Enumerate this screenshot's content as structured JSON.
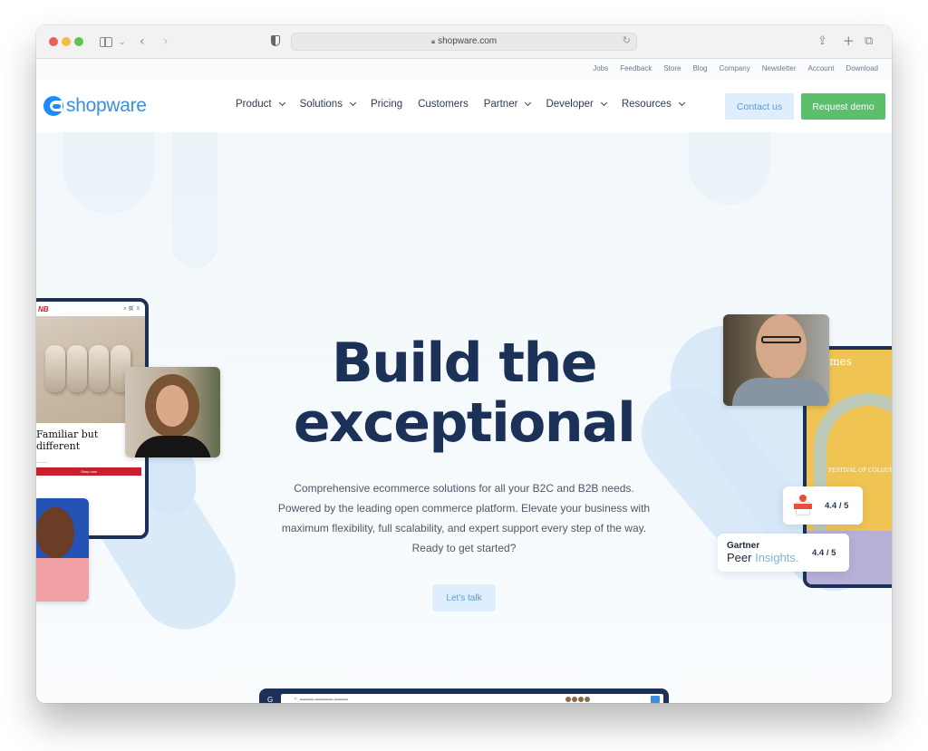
{
  "browser": {
    "url": "shopware.com",
    "icons": {
      "sidebar": "sidebar-icon",
      "back": "chevron-left-icon",
      "forward": "chevron-right-icon",
      "privacy": "shield-icon",
      "reload": "reload-icon",
      "share": "share-icon",
      "new_tab": "plus-icon",
      "tabs": "tabs-overview-icon"
    }
  },
  "utility_nav": [
    "Jobs",
    "Feedback",
    "Store",
    "Blog",
    "Company",
    "Newsletter",
    "Account",
    "Download"
  ],
  "main_nav": {
    "logo": "shopware",
    "links": [
      {
        "label": "Product",
        "dropdown": true
      },
      {
        "label": "Solutions",
        "dropdown": true
      },
      {
        "label": "Pricing",
        "dropdown": false
      },
      {
        "label": "Customers",
        "dropdown": false
      },
      {
        "label": "Partner",
        "dropdown": true
      },
      {
        "label": "Developer",
        "dropdown": true
      },
      {
        "label": "Resources",
        "dropdown": true
      }
    ],
    "contact_label": "Contact us",
    "demo_label": "Request demo"
  },
  "hero": {
    "title_line1": "Build the",
    "title_line2": "exceptional",
    "description": "Comprehensive ecommerce solutions for all your B2C and B2B needs. Powered by the leading open commerce platform. Elevate your business with maximum flexibility, full scalability, and expert support every step of the way. Ready to get started?",
    "cta_label": "Let's talk"
  },
  "showcase_left": {
    "store_heading": "Familiar but different",
    "store_button": "Shop now"
  },
  "showcase_right": {
    "store_logo": "ames",
    "store_banner": "FESTIVAL OF COLOURS"
  },
  "ratings": [
    {
      "source": "G2",
      "value": "4.4 / 5"
    },
    {
      "source_brand": "Gartner",
      "source_peer": "Peer",
      "source_insights": "Insights.",
      "value": "4.4 / 5"
    }
  ],
  "colors": {
    "brand_blue": "#1a8cff",
    "title_navy": "#1b3158",
    "demo_green": "#5cbf6b",
    "contact_bg": "#dfeefc"
  }
}
